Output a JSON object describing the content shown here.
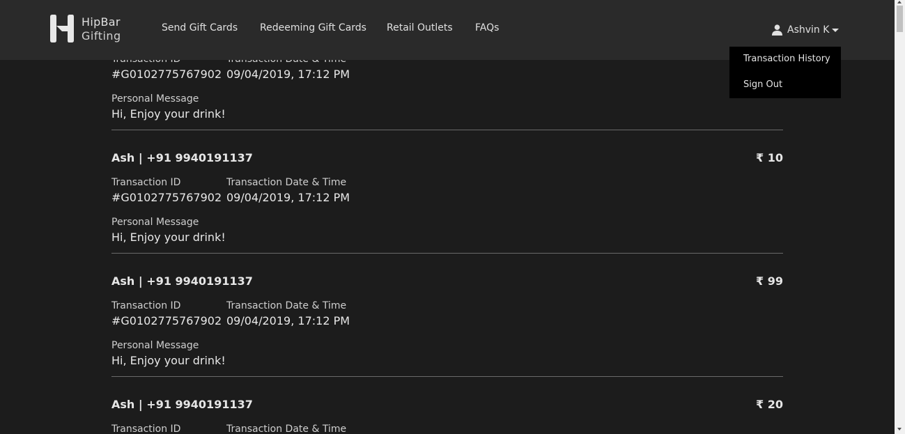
{
  "brand": {
    "line1": "HipBar",
    "line2": "Gifting"
  },
  "nav": {
    "items": [
      {
        "label": "Send Gift Cards"
      },
      {
        "label": "Redeeming Gift Cards"
      },
      {
        "label": "Retail Outlets"
      },
      {
        "label": "FAQs"
      }
    ]
  },
  "user": {
    "name": "Ashvin K",
    "icon": "user-icon",
    "dropdown": [
      {
        "label": "Transaction History"
      },
      {
        "label": "Sign Out"
      }
    ]
  },
  "labels": {
    "transaction_id": "Transaction ID",
    "transaction_datetime": "Transaction Date & Time",
    "personal_message": "Personal Message"
  },
  "transactions": [
    {
      "recipient": "",
      "amount": "",
      "transaction_id": "#G0102775767902",
      "datetime": "09/04/2019, 17:12 PM",
      "message": "Hi, Enjoy your drink!"
    },
    {
      "recipient": "Ash | +91 9940191137",
      "amount": "₹ 10",
      "transaction_id": "#G0102775767902",
      "datetime": "09/04/2019, 17:12 PM",
      "message": "Hi, Enjoy your drink!"
    },
    {
      "recipient": "Ash | +91 9940191137",
      "amount": "₹ 99",
      "transaction_id": "#G0102775767902",
      "datetime": "09/04/2019, 17:12 PM",
      "message": "Hi, Enjoy your drink!"
    },
    {
      "recipient": "Ash | +91 9940191137",
      "amount": "₹ 20",
      "transaction_id": "",
      "datetime": "",
      "message": ""
    }
  ]
}
